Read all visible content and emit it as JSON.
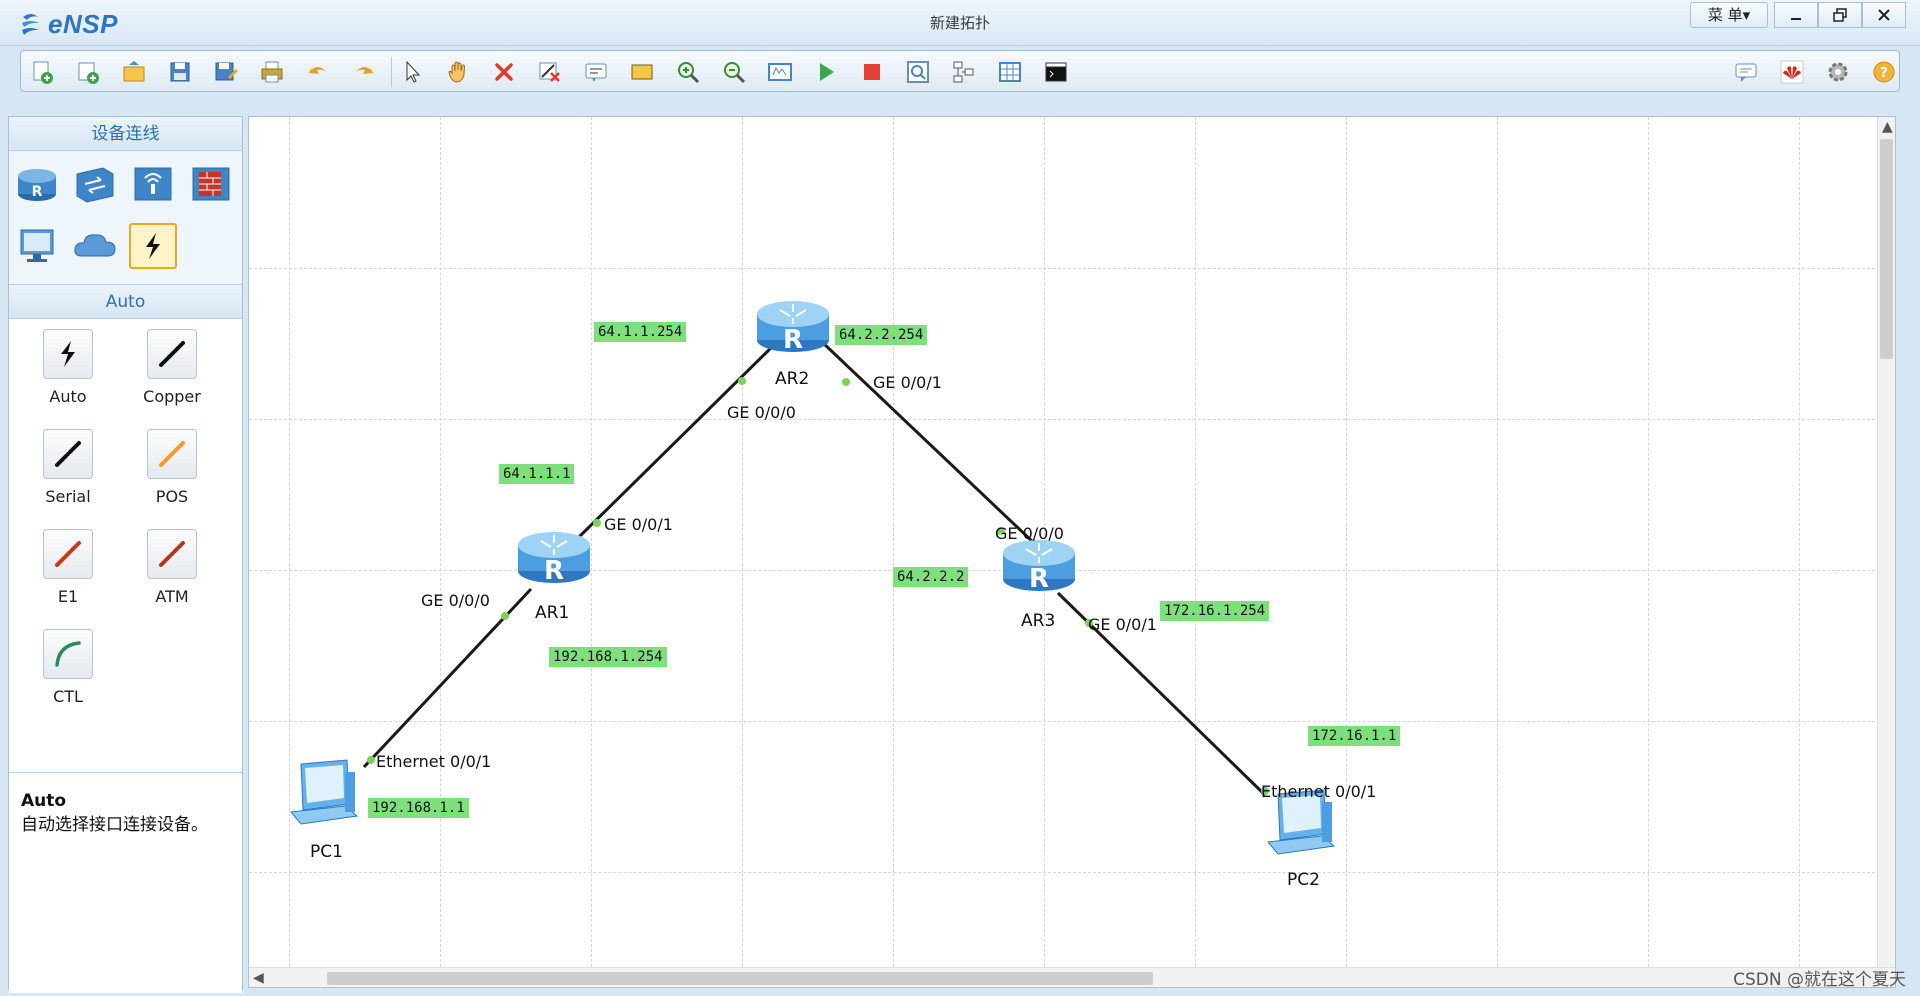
{
  "app": {
    "name": "eNSP",
    "window_title": "新建拓扑",
    "menu_label": "菜 单▾"
  },
  "toolbar": {
    "buttons": [
      "new-topology-icon",
      "new-lab-icon",
      "open-icon",
      "save-icon",
      "save-as-icon",
      "print-icon",
      "undo-icon",
      "redo-icon",
      "select-pointer-icon",
      "pan-hand-icon",
      "delete-icon",
      "delete-link-icon",
      "text-annotation-icon",
      "rectangle-icon",
      "zoom-in-icon",
      "zoom-out-icon",
      "fit-view-icon",
      "start-device-icon",
      "stop-device-icon",
      "capture-icon",
      "topology-icon",
      "grid-icon",
      "cli-icon"
    ],
    "right_buttons": [
      "chat-icon",
      "huawei-logo-icon",
      "settings-gear-icon",
      "help-icon"
    ]
  },
  "left_panel": {
    "section_title": "设备连线",
    "devices": [
      "router-icon",
      "switch-icon",
      "wireless-icon",
      "firewall-icon",
      "pc-icon",
      "cloud-icon",
      "auto-link-icon"
    ],
    "cable_section_title": "Auto",
    "cables": [
      {
        "label": "Auto",
        "color": "#111111"
      },
      {
        "label": "Copper",
        "color": "#111111"
      },
      {
        "label": "Serial",
        "color": "#111111"
      },
      {
        "label": "POS",
        "color": "#f39a2c"
      },
      {
        "label": "E1",
        "color": "#c8371b"
      },
      {
        "label": "ATM",
        "color": "#b5371b"
      },
      {
        "label": "CTL",
        "color": "#2f8a5a"
      }
    ],
    "tip": {
      "title": "Auto",
      "description": "自动选择接口连接设备。"
    }
  },
  "topology": {
    "nodes": [
      {
        "name": "AR2",
        "type": "router"
      },
      {
        "name": "AR1",
        "type": "router"
      },
      {
        "name": "AR3",
        "type": "router"
      },
      {
        "name": "PC1",
        "type": "pc"
      },
      {
        "name": "PC2",
        "type": "pc"
      }
    ],
    "links": [
      {
        "a": "PC1",
        "a_port": "Ethernet 0/0/1",
        "b": "AR1",
        "b_port": "GE 0/0/0"
      },
      {
        "a": "AR1",
        "a_port": "GE 0/0/1",
        "b": "AR2",
        "b_port": "GE 0/0/0"
      },
      {
        "a": "AR2",
        "a_port": "GE 0/0/1",
        "b": "AR3",
        "b_port": "GE 0/0/0"
      },
      {
        "a": "AR3",
        "a_port": "GE 0/0/1",
        "b": "PC2",
        "b_port": "Ethernet 0/0/1"
      }
    ],
    "ip_labels": [
      "64.1.1.254",
      "64.2.2.254",
      "64.1.1.1",
      "64.2.2.2",
      "192.168.1.254",
      "172.16.1.254",
      "172.16.1.1",
      "192.168.1.1"
    ],
    "link_color": "#1a1a1a",
    "ip_label_color": "#7de07d"
  },
  "watermark": "CSDN @就在这个夏天"
}
